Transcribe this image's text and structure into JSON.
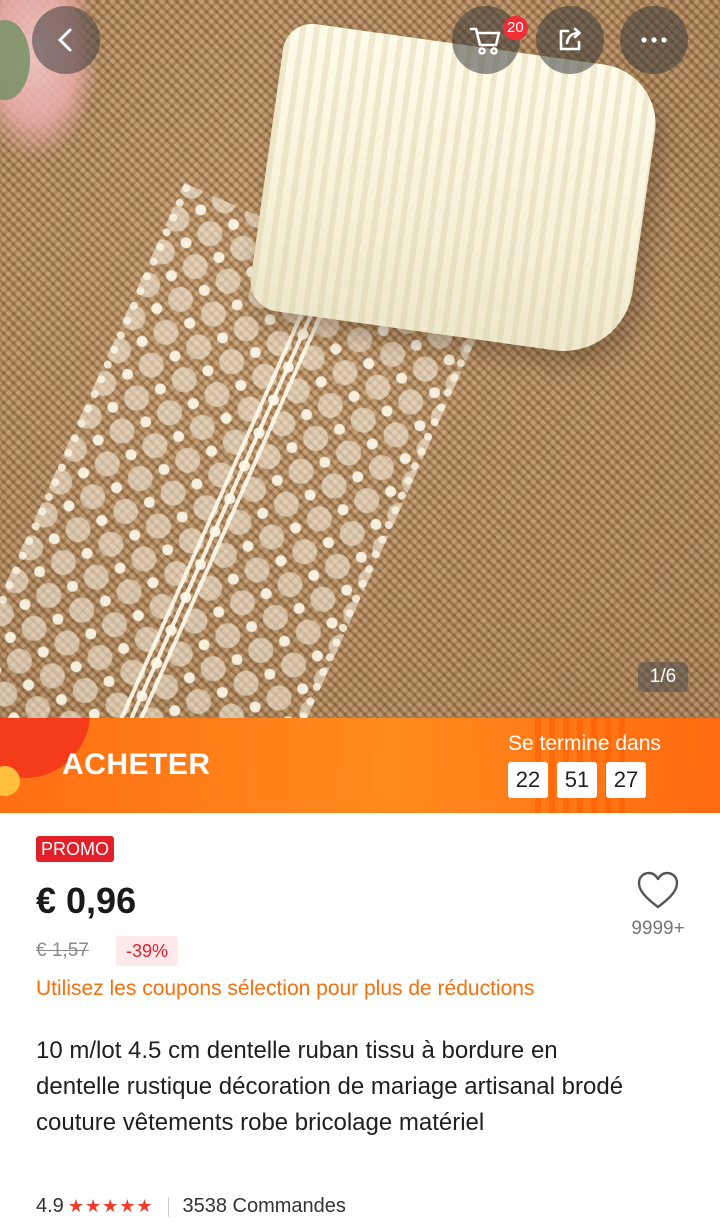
{
  "topbar": {
    "cart_badge": "20"
  },
  "gallery": {
    "page_indicator": "1/6"
  },
  "flash_banner": {
    "title": "ACHETER",
    "ends_label": "Se termine dans",
    "timer": {
      "hours": "22",
      "minutes": "51",
      "seconds": "27"
    }
  },
  "product": {
    "promo_badge": "PROMO",
    "price": "€ 0,96",
    "old_price": "€ 1,57",
    "discount": "-39%",
    "wishlist_count": "9999+",
    "coupon_text": "Utilisez les coupons sélection pour plus de réductions",
    "title": "10 m/lot 4.5 cm dentelle ruban tissu à bordure en dentelle rustique décoration de mariage artisanal brodé couture vêtements robe bricolage matériel",
    "rating": "4.9",
    "stars": "★★★★★",
    "orders": "3538 Commandes"
  },
  "colors": {
    "accent_orange": "#ff7a18",
    "promo_red": "#e3202a",
    "coupon_orange": "#f2700e",
    "star_red": "#f23b2b"
  }
}
